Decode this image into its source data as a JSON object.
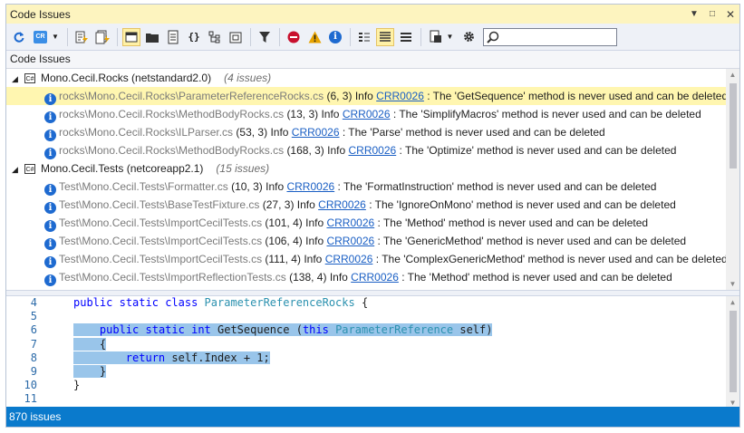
{
  "window": {
    "title": "Code Issues"
  },
  "column_header": "Code Issues",
  "search": {
    "value": "",
    "placeholder": ""
  },
  "groups": [
    {
      "name": "Mono.Cecil.Rocks (netstandard2.0)",
      "count": "(4 issues)",
      "icon": "cs",
      "issues": [
        {
          "path": "rocks\\Mono.Cecil.Rocks\\ParameterReferenceRocks.cs",
          "pos": "(6, 3)",
          "severity": "Info",
          "code": "CRR0026",
          "msg": "The 'GetSequence' method is never used and can be deleted"
        },
        {
          "path": "rocks\\Mono.Cecil.Rocks\\MethodBodyRocks.cs",
          "pos": "(13, 3)",
          "severity": "Info",
          "code": "CRR0026",
          "msg": "The 'SimplifyMacros' method is never used and can be deleted"
        },
        {
          "path": "rocks\\Mono.Cecil.Rocks\\ILParser.cs",
          "pos": "(53, 3)",
          "severity": "Info",
          "code": "CRR0026",
          "msg": "The 'Parse' method is never used and can be deleted"
        },
        {
          "path": "rocks\\Mono.Cecil.Rocks\\MethodBodyRocks.cs",
          "pos": "(168, 3)",
          "severity": "Info",
          "code": "CRR0026",
          "msg": "The 'Optimize' method is never used and can be deleted"
        }
      ]
    },
    {
      "name": "Mono.Cecil.Tests (netcoreapp2.1)",
      "count": "(15 issues)",
      "icon": "cs",
      "issues": [
        {
          "path": "Test\\Mono.Cecil.Tests\\Formatter.cs",
          "pos": "(10, 3)",
          "severity": "Info",
          "code": "CRR0026",
          "msg": "The 'FormatInstruction' method is never used and can be deleted"
        },
        {
          "path": "Test\\Mono.Cecil.Tests\\BaseTestFixture.cs",
          "pos": "(27, 3)",
          "severity": "Info",
          "code": "CRR0026",
          "msg": "The 'IgnoreOnMono' method is never used and can be deleted"
        },
        {
          "path": "Test\\Mono.Cecil.Tests\\ImportCecilTests.cs",
          "pos": "(101, 4)",
          "severity": "Info",
          "code": "CRR0026",
          "msg": "The 'Method' method is never used and can be deleted"
        },
        {
          "path": "Test\\Mono.Cecil.Tests\\ImportCecilTests.cs",
          "pos": "(106, 4)",
          "severity": "Info",
          "code": "CRR0026",
          "msg": "The 'GenericMethod' method is never used and can be deleted"
        },
        {
          "path": "Test\\Mono.Cecil.Tests\\ImportCecilTests.cs",
          "pos": "(111, 4)",
          "severity": "Info",
          "code": "CRR0026",
          "msg": "The 'ComplexGenericMethod' method is never used and can be deleted"
        },
        {
          "path": "Test\\Mono.Cecil.Tests\\ImportReflectionTests.cs",
          "pos": "(138, 4)",
          "severity": "Info",
          "code": "CRR0026",
          "msg": "The 'Method' method is never used and can be deleted"
        }
      ]
    }
  ],
  "code": {
    "lines": [
      {
        "n": "4",
        "text": "public static class ParameterReferenceRocks {"
      },
      {
        "n": "5",
        "text": ""
      },
      {
        "n": "6",
        "text": "    public static int GetSequence (this ParameterReference self)"
      },
      {
        "n": "7",
        "text": "    {"
      },
      {
        "n": "8",
        "text": "        return self.Index + 1;"
      },
      {
        "n": "9",
        "text": "    }"
      },
      {
        "n": "10",
        "text": "}"
      },
      {
        "n": "11",
        "text": ""
      }
    ]
  },
  "status": {
    "text": "870 issues"
  },
  "colors": {
    "accent": "#0a7acc",
    "selection": "#fff6b0",
    "highlight": "#99c5ea",
    "info": "#1e6ad0",
    "error": "#c8102e",
    "warning": "#e8a400"
  }
}
